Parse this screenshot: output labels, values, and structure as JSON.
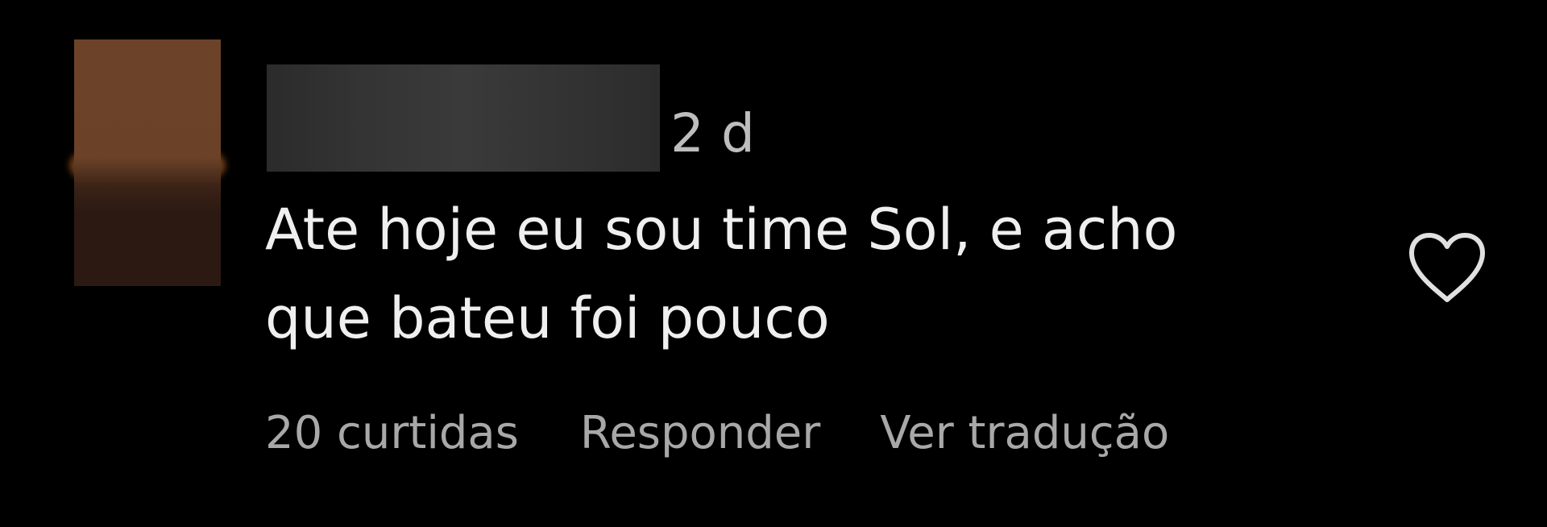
{
  "comment": {
    "timestamp": "2 d",
    "text": "Ate hoje eu sou time Sol, e acho que bateu foi pouco",
    "likes_label": "20 curtidas",
    "reply_label": "Responder",
    "translate_label": "Ver tradução",
    "like_icon": "heart-outline-icon"
  },
  "colors": {
    "background": "#000000",
    "text": "#efefef",
    "muted": "#a8a8a8"
  }
}
